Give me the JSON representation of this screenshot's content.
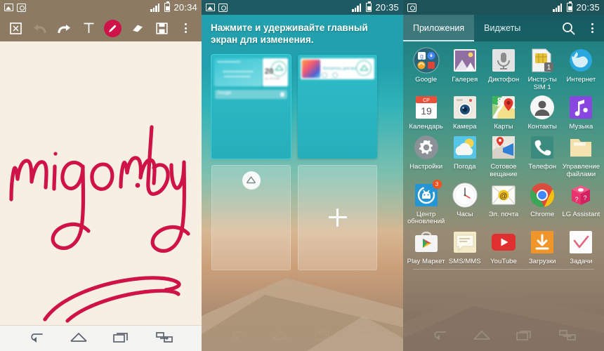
{
  "panel1": {
    "name": "note-editor",
    "statusbar": {
      "time": "20:34",
      "icons": [
        "image-icon",
        "camera-icon",
        "signal-icon",
        "battery-icon"
      ]
    },
    "toolbar": {
      "items": [
        {
          "name": "crop-fit-button",
          "icon": "crop-icon",
          "state": "normal"
        },
        {
          "name": "undo-button",
          "icon": "undo-icon",
          "state": "disabled"
        },
        {
          "name": "redo-button",
          "icon": "redo-icon",
          "state": "normal"
        },
        {
          "name": "text-tool-button",
          "icon": "text-t-icon",
          "state": "normal"
        },
        {
          "name": "pen-tool-button",
          "icon": "pen-icon",
          "state": "active"
        },
        {
          "name": "eraser-button",
          "icon": "eraser-icon",
          "state": "normal"
        },
        {
          "name": "save-button",
          "icon": "save-floppy-icon",
          "state": "normal"
        },
        {
          "name": "overflow-button",
          "icon": "more-vertical-icon",
          "state": "normal"
        }
      ],
      "accent_color": "#cf1248",
      "bar_color": "#8c7a62"
    },
    "canvas": {
      "drawing_text": "migom.by",
      "ink_color": "#cf1248",
      "paper_color": "#f7efe2"
    },
    "navbar": {
      "items": [
        "back-icon",
        "home-icon",
        "recents-icon",
        "dual-window-icon"
      ],
      "theme": "light"
    }
  },
  "panel2": {
    "name": "home-screen-editor",
    "statusbar": {
      "time": "20:35"
    },
    "hint": "Нажмите и удерживайте главный экран для изменения.",
    "pages": [
      {
        "name": "home-page-preview-1",
        "selected": true,
        "search_placeholder": "Google",
        "clock_value": "20",
        "clock_sub": "ср, 19 нояб."
      },
      {
        "name": "home-page-preview-2",
        "selected": false,
        "media_widget_text": "Коснитесь для выбора"
      }
    ],
    "slots": [
      {
        "name": "home-page-slot-default",
        "badge": "home-icon"
      },
      {
        "name": "add-page-slot",
        "badge": "plus-icon"
      }
    ],
    "navbar": {
      "items": [
        "back-icon",
        "home-icon",
        "recents-icon",
        "dual-window-icon"
      ],
      "theme": "dark"
    }
  },
  "panel3": {
    "name": "app-drawer",
    "statusbar": {
      "time": "20:35"
    },
    "tabs": [
      {
        "label": "Приложения",
        "active": true
      },
      {
        "label": "Виджеты",
        "active": false
      }
    ],
    "actions": [
      {
        "name": "search-button",
        "icon": "search-icon"
      },
      {
        "name": "overflow-button",
        "icon": "more-vertical-icon"
      }
    ],
    "apps": [
      [
        {
          "label": "Google",
          "icon": "google-folder-icon",
          "badge": ""
        },
        {
          "label": "Галерея",
          "icon": "gallery-icon",
          "badge": ""
        },
        {
          "label": "Диктофон",
          "icon": "voice-recorder-icon",
          "badge": ""
        },
        {
          "label": "Инстр-ты SIM 1",
          "icon": "sim-toolkit-icon",
          "badge": "1"
        },
        {
          "label": "Интернет",
          "icon": "browser-globe-icon",
          "badge": ""
        }
      ],
      [
        {
          "label": "Календарь",
          "icon": "calendar-icon",
          "badge": "",
          "extra": "19",
          "extra2": "СР"
        },
        {
          "label": "Камера",
          "icon": "camera-icon",
          "badge": ""
        },
        {
          "label": "Карты",
          "icon": "maps-icon",
          "badge": ""
        },
        {
          "label": "Контакты",
          "icon": "contacts-icon",
          "badge": ""
        },
        {
          "label": "Музыка",
          "icon": "music-icon",
          "badge": ""
        }
      ],
      [
        {
          "label": "Настройки",
          "icon": "settings-gear-icon",
          "badge": ""
        },
        {
          "label": "Погода",
          "icon": "weather-icon",
          "badge": ""
        },
        {
          "label": "Сотовое вещание",
          "icon": "cell-broadcast-icon",
          "badge": ""
        },
        {
          "label": "Телефон",
          "icon": "phone-icon",
          "badge": ""
        },
        {
          "label": "Управление файлами",
          "icon": "file-manager-icon",
          "badge": ""
        }
      ],
      [
        {
          "label": "Центр обновлений",
          "icon": "update-center-icon",
          "badge": "3"
        },
        {
          "label": "Часы",
          "icon": "clock-icon",
          "badge": ""
        },
        {
          "label": "Эл. почта",
          "icon": "email-icon",
          "badge": ""
        },
        {
          "label": "Chrome",
          "icon": "chrome-icon",
          "badge": ""
        },
        {
          "label": "LG Assistant",
          "icon": "lg-assistant-dice-icon",
          "badge": ""
        }
      ],
      [
        {
          "label": "Play Маркет",
          "icon": "play-store-icon",
          "badge": ""
        },
        {
          "label": "SMS/MMS",
          "icon": "messaging-icon",
          "badge": ""
        },
        {
          "label": "YouTube",
          "icon": "youtube-icon",
          "badge": ""
        },
        {
          "label": "Загрузки",
          "icon": "downloads-icon",
          "badge": ""
        },
        {
          "label": "Задачи",
          "icon": "tasks-icon",
          "badge": ""
        }
      ]
    ],
    "navbar": {
      "items": [
        "back-icon",
        "home-icon",
        "recents-icon",
        "dual-window-icon"
      ],
      "theme": "dark"
    }
  }
}
